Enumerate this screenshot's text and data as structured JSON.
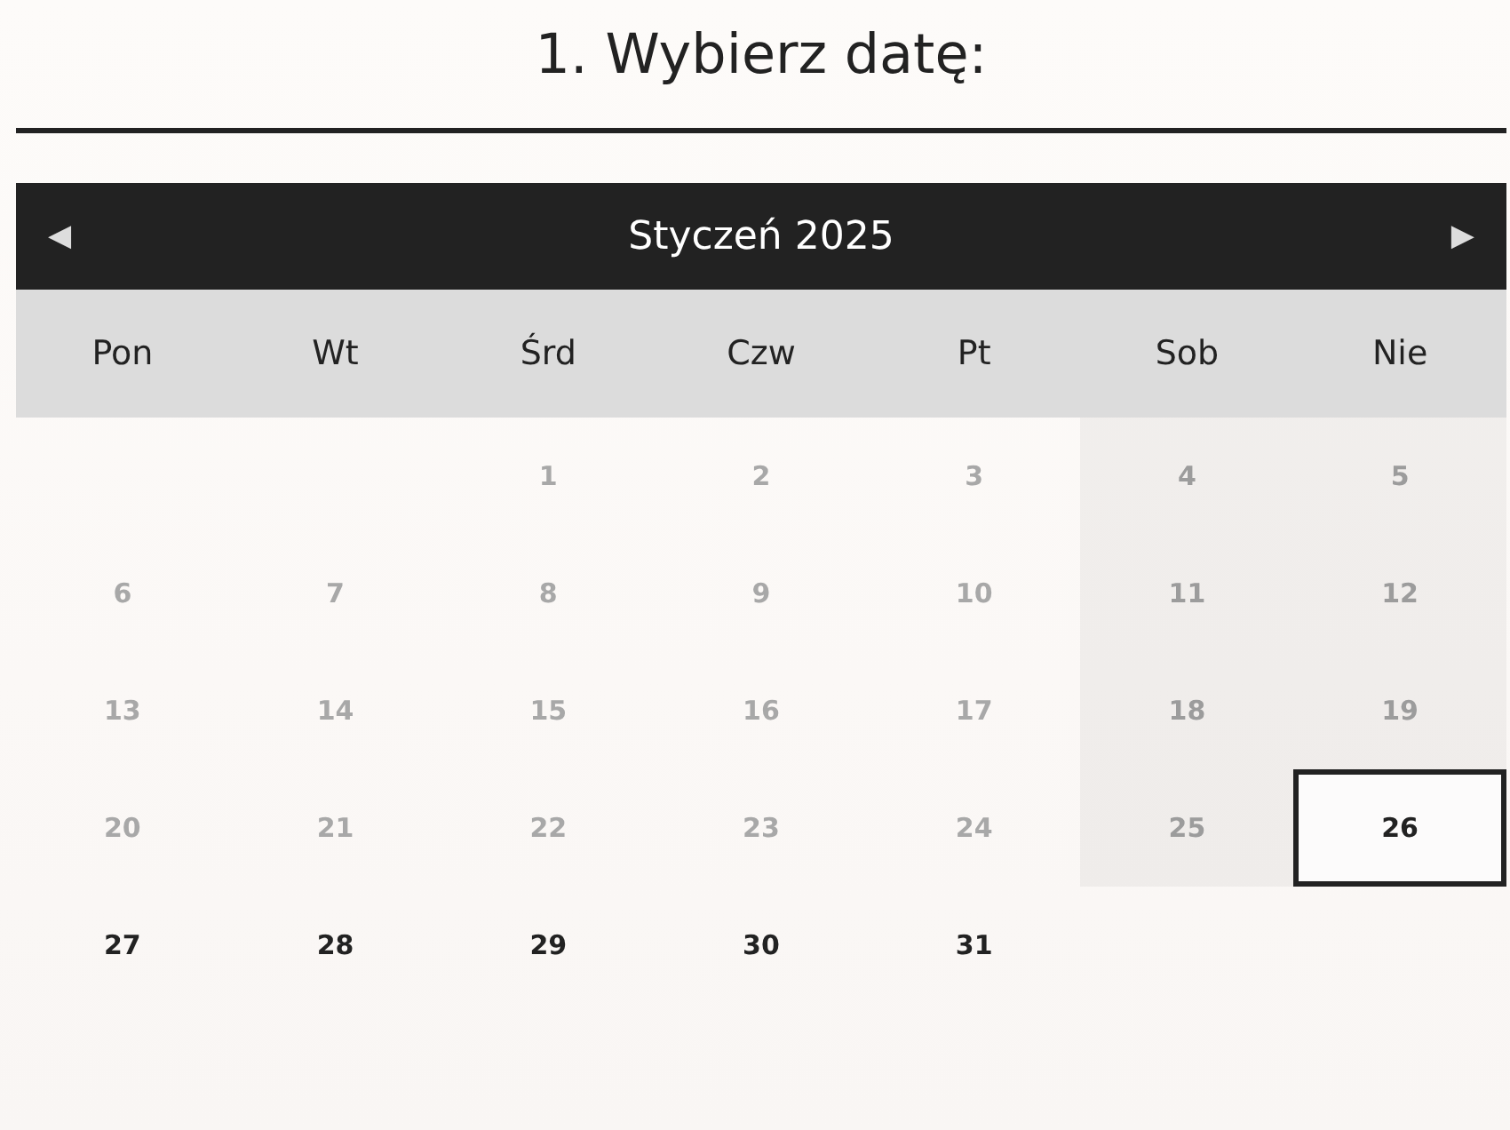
{
  "heading": "1. Wybierz datę:",
  "calendar": {
    "prev": "◀",
    "month": "Styczeń 2025",
    "next": "▶",
    "weekdays": [
      "Pon",
      "Wt",
      "Śrd",
      "Czw",
      "Pt",
      "Sob",
      "Nie"
    ],
    "days": [
      {
        "kind": "blank"
      },
      {
        "kind": "blank"
      },
      {
        "kind": "day",
        "label": "1",
        "disabled": true,
        "selected": false
      },
      {
        "kind": "day",
        "label": "2",
        "disabled": true,
        "selected": false
      },
      {
        "kind": "day",
        "label": "3",
        "disabled": true,
        "selected": false
      },
      {
        "kind": "day",
        "label": "4",
        "disabled": true,
        "selected": false
      },
      {
        "kind": "day",
        "label": "5",
        "disabled": true,
        "selected": false
      },
      {
        "kind": "day",
        "label": "6",
        "disabled": true,
        "selected": false
      },
      {
        "kind": "day",
        "label": "7",
        "disabled": true,
        "selected": false
      },
      {
        "kind": "day",
        "label": "8",
        "disabled": true,
        "selected": false
      },
      {
        "kind": "day",
        "label": "9",
        "disabled": true,
        "selected": false
      },
      {
        "kind": "day",
        "label": "10",
        "disabled": true,
        "selected": false
      },
      {
        "kind": "day",
        "label": "11",
        "disabled": true,
        "selected": false
      },
      {
        "kind": "day",
        "label": "12",
        "disabled": true,
        "selected": false
      },
      {
        "kind": "day",
        "label": "13",
        "disabled": true,
        "selected": false
      },
      {
        "kind": "day",
        "label": "14",
        "disabled": true,
        "selected": false
      },
      {
        "kind": "day",
        "label": "15",
        "disabled": true,
        "selected": false
      },
      {
        "kind": "day",
        "label": "16",
        "disabled": true,
        "selected": false
      },
      {
        "kind": "day",
        "label": "17",
        "disabled": true,
        "selected": false
      },
      {
        "kind": "day",
        "label": "18",
        "disabled": true,
        "selected": false
      },
      {
        "kind": "day",
        "label": "19",
        "disabled": true,
        "selected": false
      },
      {
        "kind": "day",
        "label": "20",
        "disabled": true,
        "selected": false
      },
      {
        "kind": "day",
        "label": "21",
        "disabled": true,
        "selected": false
      },
      {
        "kind": "day",
        "label": "22",
        "disabled": true,
        "selected": false
      },
      {
        "kind": "day",
        "label": "23",
        "disabled": true,
        "selected": false
      },
      {
        "kind": "day",
        "label": "24",
        "disabled": true,
        "selected": false
      },
      {
        "kind": "day",
        "label": "25",
        "disabled": true,
        "selected": false
      },
      {
        "kind": "day",
        "label": "26",
        "disabled": false,
        "selected": true
      },
      {
        "kind": "day",
        "label": "27",
        "disabled": false,
        "selected": false
      },
      {
        "kind": "day",
        "label": "28",
        "disabled": false,
        "selected": false
      },
      {
        "kind": "day",
        "label": "29",
        "disabled": false,
        "selected": false
      },
      {
        "kind": "day",
        "label": "30",
        "disabled": false,
        "selected": false
      },
      {
        "kind": "day",
        "label": "31",
        "disabled": false,
        "selected": false
      }
    ]
  }
}
